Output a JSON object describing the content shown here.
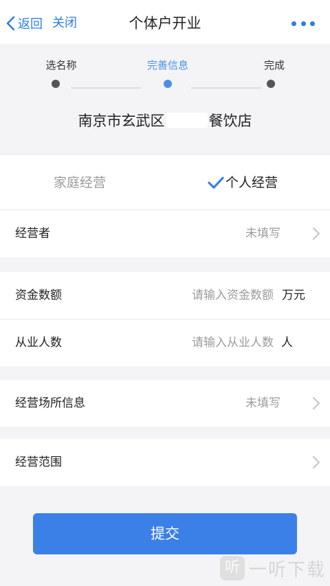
{
  "nav": {
    "back_label": "返回",
    "close_label": "关闭",
    "title": "个体户开业"
  },
  "steps": [
    {
      "label": "选名称",
      "active": false
    },
    {
      "label": "完善信息",
      "active": true
    },
    {
      "label": "完成",
      "active": false
    }
  ],
  "shop": {
    "name_prefix": "南京市玄武区",
    "name_suffix": "餐饮店"
  },
  "business_type": {
    "options": [
      "家庭经营",
      "个人经营"
    ],
    "selected": "个人经营"
  },
  "form": {
    "operator": {
      "label": "经营者",
      "value": "未填写"
    },
    "capital": {
      "label": "资金数额",
      "placeholder": "请输入资金数额",
      "unit": "万元"
    },
    "employees": {
      "label": "从业人数",
      "placeholder": "请输入从业人数",
      "unit": "人"
    },
    "premises": {
      "label": "经营场所信息",
      "value": "未填写"
    },
    "scope": {
      "label": "经营范围"
    }
  },
  "submit_label": "提交",
  "watermark": {
    "logo": "听",
    "text": "一听下载"
  },
  "colors": {
    "accent": "#3b80e6",
    "link": "#2f7de1",
    "step_active": "#4a90e2"
  }
}
